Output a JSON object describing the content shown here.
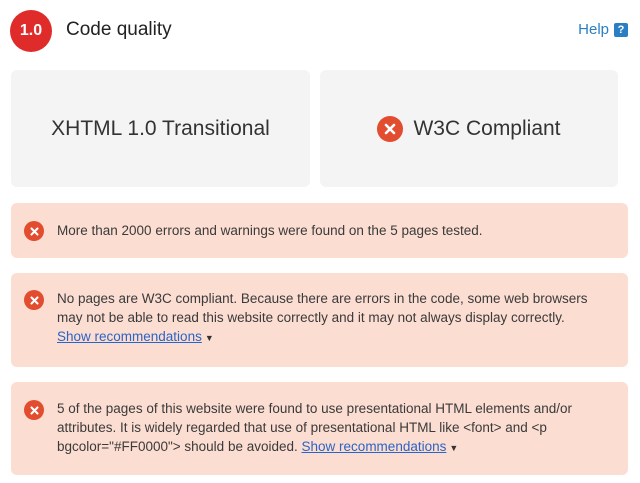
{
  "header": {
    "score": "1.0",
    "title": "Code quality",
    "help_label": "Help",
    "help_icon_glyph": "?"
  },
  "cards": {
    "doctype": "XHTML 1.0 Transitional",
    "w3c": "W3C Compliant"
  },
  "alerts": [
    {
      "text": "More than 2000 errors and warnings were found on the 5 pages tested."
    },
    {
      "text": "No pages are W3C compliant. Because there are errors in the code, some web browsers may not be able to read this website correctly and it may not always display correctly.",
      "link": "Show recommendations"
    },
    {
      "text": "5 of the pages of this website were found to use presentational HTML elements and/or attributes. It is widely regarded that use of presentational HTML like <font> and <p bgcolor=\"#FF0000\"> should be avoided.",
      "link": "Show recommendations"
    }
  ],
  "colors": {
    "badge": "#e02b2b",
    "error_icon": "#e24c2f",
    "alert_bg": "#fcddd2",
    "card_bg": "#f4f4f4",
    "link": "#2a64c4",
    "help": "#2a7fc4"
  },
  "icons": {
    "error": "x-circle-icon",
    "dropdown": "caret-down-icon",
    "help": "question-icon"
  }
}
